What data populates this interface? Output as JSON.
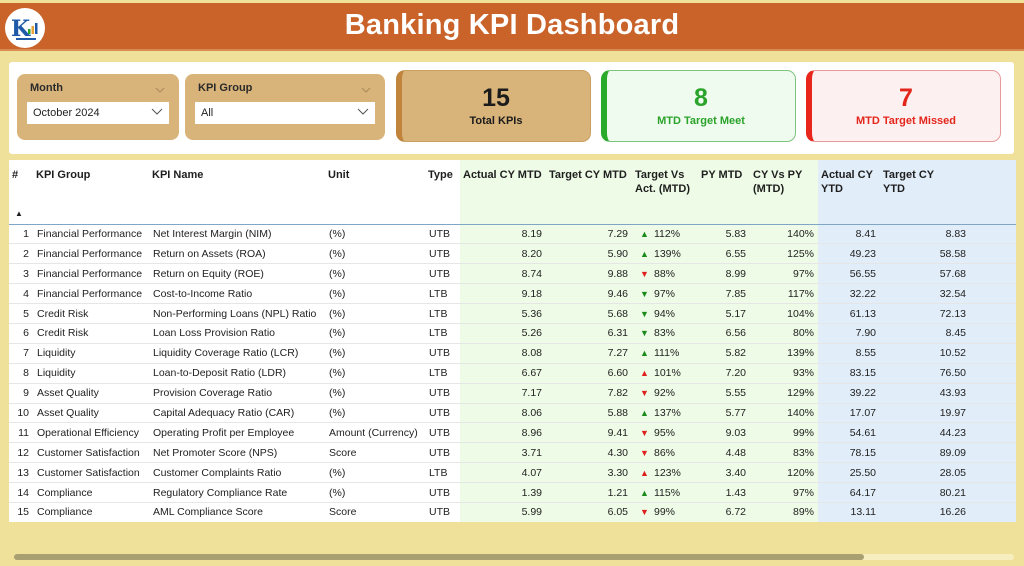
{
  "header": {
    "title": "Banking KPI Dashboard",
    "logo_icon": "kpi-logo-icon"
  },
  "filters": {
    "month": {
      "label": "Month",
      "value": "October 2024"
    },
    "kpi_group": {
      "label": "KPI Group",
      "value": "All"
    }
  },
  "cards": {
    "total": {
      "value": "15",
      "caption": "Total KPIs"
    },
    "meet": {
      "value": "8",
      "caption": "MTD Target Meet",
      "color": "#2aa32a"
    },
    "missed": {
      "value": "7",
      "caption": "MTD Target Missed",
      "color": "#e2261b"
    }
  },
  "colors": {
    "header": "#c9632a",
    "background": "#f0e19a",
    "card_neutral": "#d9b47a",
    "good": "#1a8a1a",
    "bad": "#e01f1f",
    "mtd_column_bg": "#eefbe6",
    "ytd_column_bg": "#e1edf8"
  },
  "table": {
    "columns": [
      "#",
      "KPI Group",
      "KPI Name",
      "Unit",
      "Type",
      "Actual CY MTD",
      "Target CY MTD",
      "Target Vs Act. (MTD)",
      "PY MTD",
      "CY Vs PY (MTD)",
      "Actual CY YTD",
      "Target CY YTD"
    ],
    "sort_indicator": "▲",
    "rows": [
      {
        "n": "1",
        "group": "Financial Performance",
        "name": "Net Interest Margin (NIM)",
        "unit": "(%)",
        "type": "UTB",
        "act_mtd": "8.19",
        "tgt_mtd": "7.29",
        "arrow": "▲",
        "arrow_status": "up-good",
        "tva": "112%",
        "py_mtd": "5.83",
        "cy_vs_py": "140%",
        "act_ytd": "8.41",
        "tgt_ytd": "8.83"
      },
      {
        "n": "2",
        "group": "Financial Performance",
        "name": "Return on Assets (ROA)",
        "unit": "(%)",
        "type": "UTB",
        "act_mtd": "8.20",
        "tgt_mtd": "5.90",
        "arrow": "▲",
        "arrow_status": "up-good",
        "tva": "139%",
        "py_mtd": "6.55",
        "cy_vs_py": "125%",
        "act_ytd": "49.23",
        "tgt_ytd": "58.58"
      },
      {
        "n": "3",
        "group": "Financial Performance",
        "name": "Return on Equity (ROE)",
        "unit": "(%)",
        "type": "UTB",
        "act_mtd": "8.74",
        "tgt_mtd": "9.88",
        "arrow": "▼",
        "arrow_status": "down-bad",
        "tva": "88%",
        "py_mtd": "8.99",
        "cy_vs_py": "97%",
        "act_ytd": "56.55",
        "tgt_ytd": "57.68"
      },
      {
        "n": "4",
        "group": "Financial Performance",
        "name": "Cost-to-Income Ratio",
        "unit": "(%)",
        "type": "LTB",
        "act_mtd": "9.18",
        "tgt_mtd": "9.46",
        "arrow": "▼",
        "arrow_status": "down-good",
        "tva": "97%",
        "py_mtd": "7.85",
        "cy_vs_py": "117%",
        "act_ytd": "32.22",
        "tgt_ytd": "32.54"
      },
      {
        "n": "5",
        "group": "Credit Risk",
        "name": "Non-Performing Loans (NPL) Ratio",
        "unit": "(%)",
        "type": "LTB",
        "act_mtd": "5.36",
        "tgt_mtd": "5.68",
        "arrow": "▼",
        "arrow_status": "down-good",
        "tva": "94%",
        "py_mtd": "5.17",
        "cy_vs_py": "104%",
        "act_ytd": "61.13",
        "tgt_ytd": "72.13"
      },
      {
        "n": "6",
        "group": "Credit Risk",
        "name": "Loan Loss Provision Ratio",
        "unit": "(%)",
        "type": "LTB",
        "act_mtd": "5.26",
        "tgt_mtd": "6.31",
        "arrow": "▼",
        "arrow_status": "down-good",
        "tva": "83%",
        "py_mtd": "6.56",
        "cy_vs_py": "80%",
        "act_ytd": "7.90",
        "tgt_ytd": "8.45"
      },
      {
        "n": "7",
        "group": "Liquidity",
        "name": "Liquidity Coverage Ratio (LCR)",
        "unit": "(%)",
        "type": "UTB",
        "act_mtd": "8.08",
        "tgt_mtd": "7.27",
        "arrow": "▲",
        "arrow_status": "up-good",
        "tva": "111%",
        "py_mtd": "5.82",
        "cy_vs_py": "139%",
        "act_ytd": "8.55",
        "tgt_ytd": "10.52"
      },
      {
        "n": "8",
        "group": "Liquidity",
        "name": "Loan-to-Deposit Ratio (LDR)",
        "unit": "(%)",
        "type": "LTB",
        "act_mtd": "6.67",
        "tgt_mtd": "6.60",
        "arrow": "▲",
        "arrow_status": "up-bad",
        "tva": "101%",
        "py_mtd": "7.20",
        "cy_vs_py": "93%",
        "act_ytd": "83.15",
        "tgt_ytd": "76.50"
      },
      {
        "n": "9",
        "group": "Asset Quality",
        "name": "Provision Coverage Ratio",
        "unit": "(%)",
        "type": "UTB",
        "act_mtd": "7.17",
        "tgt_mtd": "7.82",
        "arrow": "▼",
        "arrow_status": "down-bad",
        "tva": "92%",
        "py_mtd": "5.55",
        "cy_vs_py": "129%",
        "act_ytd": "39.22",
        "tgt_ytd": "43.93"
      },
      {
        "n": "10",
        "group": "Asset Quality",
        "name": "Capital Adequacy Ratio (CAR)",
        "unit": "(%)",
        "type": "UTB",
        "act_mtd": "8.06",
        "tgt_mtd": "5.88",
        "arrow": "▲",
        "arrow_status": "up-good",
        "tva": "137%",
        "py_mtd": "5.77",
        "cy_vs_py": "140%",
        "act_ytd": "17.07",
        "tgt_ytd": "19.97"
      },
      {
        "n": "11",
        "group": "Operational Efficiency",
        "name": "Operating Profit per Employee",
        "unit": "Amount (Currency)",
        "type": "UTB",
        "act_mtd": "8.96",
        "tgt_mtd": "9.41",
        "arrow": "▼",
        "arrow_status": "down-bad",
        "tva": "95%",
        "py_mtd": "9.03",
        "cy_vs_py": "99%",
        "act_ytd": "54.61",
        "tgt_ytd": "44.23"
      },
      {
        "n": "12",
        "group": "Customer Satisfaction",
        "name": "Net Promoter Score (NPS)",
        "unit": "Score",
        "type": "UTB",
        "act_mtd": "3.71",
        "tgt_mtd": "4.30",
        "arrow": "▼",
        "arrow_status": "down-bad",
        "tva": "86%",
        "py_mtd": "4.48",
        "cy_vs_py": "83%",
        "act_ytd": "78.15",
        "tgt_ytd": "89.09"
      },
      {
        "n": "13",
        "group": "Customer Satisfaction",
        "name": "Customer Complaints Ratio",
        "unit": " (%)",
        "type": "LTB",
        "act_mtd": "4.07",
        "tgt_mtd": "3.30",
        "arrow": "▲",
        "arrow_status": "up-bad",
        "tva": "123%",
        "py_mtd": "3.40",
        "cy_vs_py": "120%",
        "act_ytd": "25.50",
        "tgt_ytd": "28.05"
      },
      {
        "n": "14",
        "group": "Compliance",
        "name": "Regulatory Compliance Rate",
        "unit": " (%)",
        "type": "UTB",
        "act_mtd": "1.39",
        "tgt_mtd": "1.21",
        "arrow": "▲",
        "arrow_status": "up-good",
        "tva": "115%",
        "py_mtd": "1.43",
        "cy_vs_py": "97%",
        "act_ytd": "64.17",
        "tgt_ytd": "80.21"
      },
      {
        "n": "15",
        "group": "Compliance",
        "name": "AML Compliance Score",
        "unit": "Score",
        "type": "UTB",
        "act_mtd": "5.99",
        "tgt_mtd": "6.05",
        "arrow": "▼",
        "arrow_status": "down-bad",
        "tva": "99%",
        "py_mtd": "6.72",
        "cy_vs_py": "89%",
        "act_ytd": "13.11",
        "tgt_ytd": "16.26"
      }
    ]
  },
  "scrollbar": {
    "position_fraction": 0.0,
    "visible_fraction": 0.85
  }
}
